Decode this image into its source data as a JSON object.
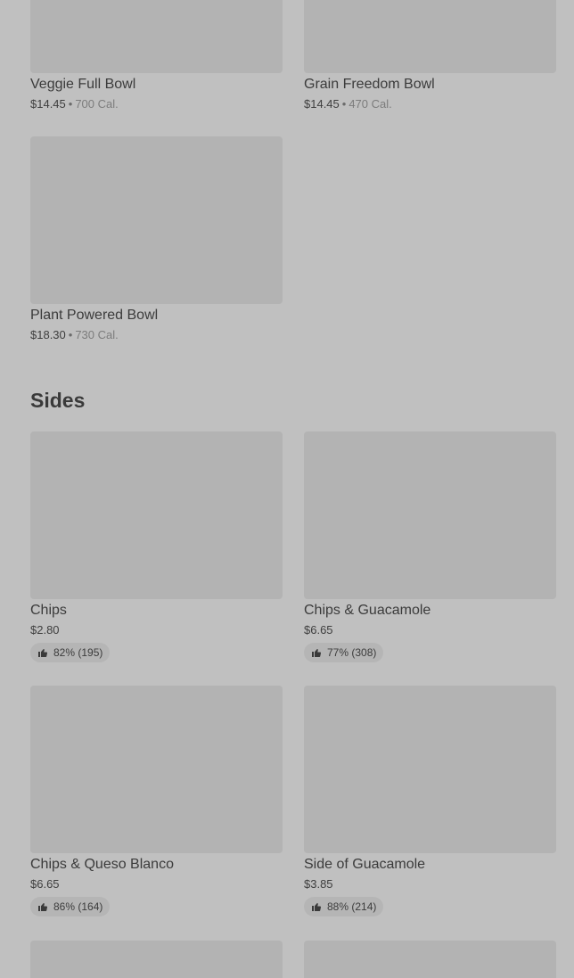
{
  "bowls": [
    {
      "name": "Veggie Full Bowl",
      "price": "$14.45",
      "calories": "700 Cal."
    },
    {
      "name": "Grain Freedom Bowl",
      "price": "$14.45",
      "calories": "470 Cal."
    },
    {
      "name": "Plant Powered Bowl",
      "price": "$18.30",
      "calories": "730 Cal."
    }
  ],
  "sides": {
    "title": "Sides",
    "items": [
      {
        "name": "Chips",
        "price": "$2.80",
        "rating": "82% (195)"
      },
      {
        "name": "Chips & Guacamole",
        "price": "$6.65",
        "rating": "77% (308)"
      },
      {
        "name": "Chips & Queso Blanco",
        "price": "$6.65",
        "rating": "86% (164)"
      },
      {
        "name": "Side of Guacamole",
        "price": "$3.85",
        "rating": "88% (214)"
      }
    ]
  },
  "separator": "•",
  "icons": {
    "rating": "thumbs-up-icon"
  },
  "colors": {
    "background": "#c0c0c0",
    "placeholder": "#b3b3b3"
  }
}
